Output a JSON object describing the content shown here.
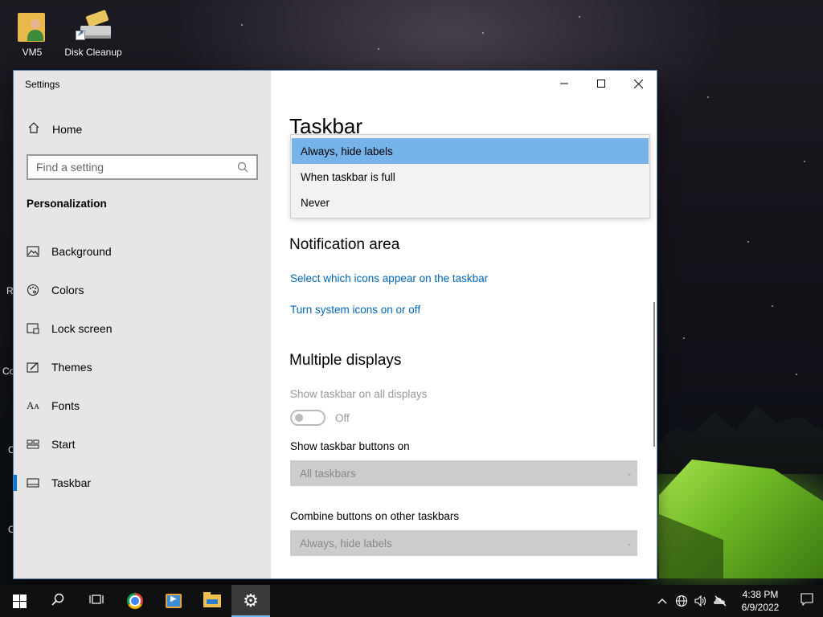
{
  "desktop": {
    "icons": [
      {
        "label": "VM5"
      },
      {
        "label": "Disk Cleanup"
      }
    ],
    "edge_texts": [
      "R",
      "Co",
      "C",
      "C"
    ]
  },
  "settings_window": {
    "title": "Settings",
    "caption": {
      "minimize": "—",
      "maximize": "☐",
      "close": "✕"
    },
    "sidebar": {
      "home_label": "Home",
      "search_placeholder": "Find a setting",
      "section": "Personalization",
      "items": [
        {
          "label": "Background",
          "icon": "background-icon",
          "active": false
        },
        {
          "label": "Colors",
          "icon": "palette-icon",
          "active": false
        },
        {
          "label": "Lock screen",
          "icon": "lock-screen-icon",
          "active": false
        },
        {
          "label": "Themes",
          "icon": "themes-icon",
          "active": false
        },
        {
          "label": "Fonts",
          "icon": "fonts-icon",
          "active": false
        },
        {
          "label": "Start",
          "icon": "start-icon",
          "active": false
        },
        {
          "label": "Taskbar",
          "icon": "taskbar-icon",
          "active": true
        }
      ]
    },
    "content": {
      "page_title": "Taskbar",
      "dropdown_options": [
        "Always, hide labels",
        "When taskbar is full",
        "Never"
      ],
      "dropdown_selected": "Always, hide labels",
      "notification_area": {
        "heading": "Notification area",
        "link1": "Select which icons appear on the taskbar",
        "link2": "Turn system icons on or off"
      },
      "multiple_displays": {
        "heading": "Multiple displays",
        "show_all_label": "Show taskbar on all displays",
        "toggle_state": "Off",
        "show_buttons_label": "Show taskbar buttons on",
        "show_buttons_value": "All taskbars",
        "combine_label": "Combine buttons on other taskbars",
        "combine_value": "Always, hide labels"
      }
    }
  },
  "taskbar": {
    "clock_time": "4:38 PM",
    "clock_date": "6/9/2022",
    "accent": "#76b9ed"
  }
}
